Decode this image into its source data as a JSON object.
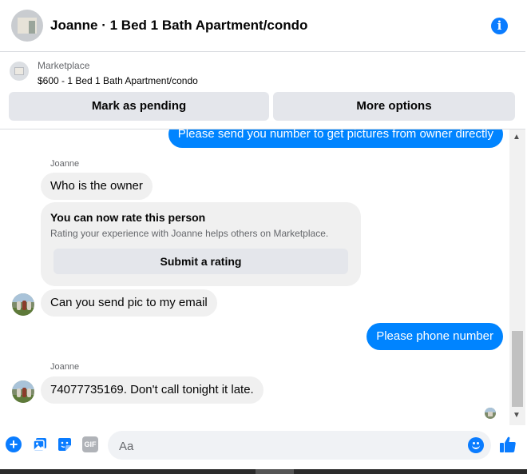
{
  "header": {
    "title": "Joanne · 1 Bed 1 Bath Apartment/condo"
  },
  "marketplace": {
    "label": "Marketplace",
    "listing": "$600 - 1 Bed 1 Bath Apartment/condo",
    "mark_pending_label": "Mark as pending",
    "more_options_label": "More options"
  },
  "messages": {
    "m1": "Please send you number to get pictures from owner directly",
    "sender1": "Joanne",
    "m2": "Who is the owner",
    "rate_title": "You can now rate this person",
    "rate_subtitle": "Rating your experience with Joanne helps others on Marketplace.",
    "rate_button": "Submit a rating",
    "m3": "Can you send pic to my email",
    "m4": "Please phone number",
    "sender2": "Joanne",
    "m5": "74077735169. Don't call tonight it late."
  },
  "composer": {
    "placeholder": "Aa",
    "gif_label": "GIF"
  },
  "colors": {
    "accent": "#0084ff",
    "bubble_in": "#f0f0f0"
  }
}
